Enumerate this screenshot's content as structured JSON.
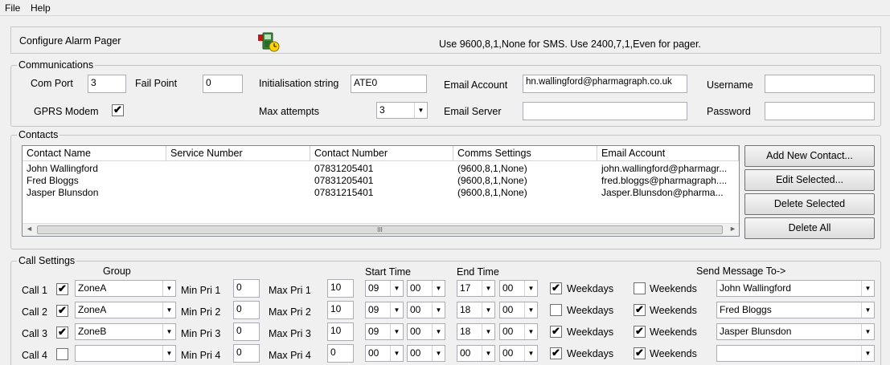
{
  "menu": {
    "file": "File",
    "help": "Help"
  },
  "header": {
    "title": "Configure Alarm Pager",
    "icon": "pager-clock-icon",
    "hint": "Use 9600,8,1,None for SMS.  Use 2400,7,1,Even for pager."
  },
  "comms": {
    "legend": "Communications",
    "com_port_label": "Com Port",
    "com_port": "3",
    "fail_point_label": "Fail Point",
    "fail_point": "0",
    "init_label": "Initialisation string",
    "init": "ATE0",
    "email_account_label": "Email Account",
    "email_account": "hn.wallingford@pharmagraph.co.uk",
    "username_label": "Username",
    "username": "",
    "gprs_label": "GPRS Modem",
    "gprs_checked": "✔",
    "max_attempts_label": "Max attempts",
    "max_attempts": "3",
    "email_server_label": "Email Server",
    "email_server": "",
    "password_label": "Password",
    "password": ""
  },
  "contacts": {
    "legend": "Contacts",
    "columns": [
      "Contact Name",
      "Service Number",
      "Contact Number",
      "Comms Settings",
      "Email Account"
    ],
    "rows": [
      [
        "John Wallingford",
        "",
        "07831205401",
        "(9600,8,1,None)",
        "john.wallingford@pharmagr..."
      ],
      [
        "Fred Bloggs",
        "",
        "07831205401",
        "(9600,8,1,None)",
        "fred.bloggs@pharmagraph...."
      ],
      [
        "Jasper Blunsdon",
        "",
        "07831215401",
        "(9600,8,1,None)",
        "Jasper.Blunsdon@pharma..."
      ]
    ],
    "scroll_grip": "III",
    "buttons": {
      "add": "Add New Contact...",
      "edit": "Edit Selected...",
      "delete": "Delete Selected",
      "delete_all": "Delete All"
    }
  },
  "calls": {
    "legend": "Call Settings",
    "group_header": "Group",
    "start_header": "Start Time",
    "end_header": "End Time",
    "send_header": "Send Message To->",
    "weekdays_label": "Weekdays",
    "weekends_label": "Weekends",
    "rows": [
      {
        "label": "Call 1",
        "enabled": "✔",
        "group": "ZoneA",
        "min_label": "Min Pri 1",
        "min": "0",
        "max_label": "Max Pri 1",
        "max": "10",
        "start_h": "09",
        "start_m": "00",
        "end_h": "17",
        "end_m": "00",
        "weekdays": "✔",
        "weekends": "",
        "send_to": "John Wallingford"
      },
      {
        "label": "Call 2",
        "enabled": "✔",
        "group": "ZoneA",
        "min_label": "Min Pri 2",
        "min": "0",
        "max_label": "Max Pri 2",
        "max": "10",
        "start_h": "09",
        "start_m": "00",
        "end_h": "18",
        "end_m": "00",
        "weekdays": "",
        "weekends": "✔",
        "send_to": "Fred Bloggs"
      },
      {
        "label": "Call 3",
        "enabled": "✔",
        "group": "ZoneB",
        "min_label": "Min Pri 3",
        "min": "0",
        "max_label": "Max Pri 3",
        "max": "10",
        "start_h": "09",
        "start_m": "00",
        "end_h": "18",
        "end_m": "00",
        "weekdays": "✔",
        "weekends": "✔",
        "send_to": "Jasper Blunsdon"
      },
      {
        "label": "Call 4",
        "enabled": "",
        "group": "",
        "min_label": "Min Pri 4",
        "min": "0",
        "max_label": "Max Pri 4",
        "max": "0",
        "start_h": "00",
        "start_m": "00",
        "end_h": "00",
        "end_m": "00",
        "weekdays": "✔",
        "weekends": "✔",
        "send_to": ""
      }
    ]
  }
}
